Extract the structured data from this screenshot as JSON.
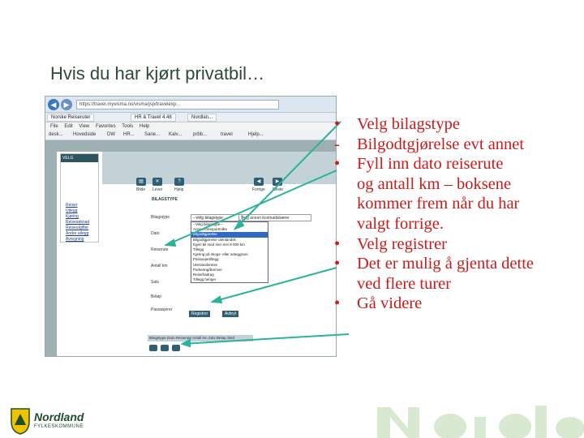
{
  "slide": {
    "title": "Hvis du har kjørt privatbil…",
    "bullets": [
      {
        "marker": "•",
        "lines": [
          "Velg bilagstype"
        ]
      },
      {
        "marker": "-",
        "lines": [
          "Bilgodtgjørelse evt annet"
        ]
      },
      {
        "marker": "•",
        "lines": [
          "Fyll inn dato reiserute",
          "og antall km – boksene",
          "kommer frem når du har",
          "valgt forrige."
        ]
      },
      {
        "marker": "•",
        "lines": [
          "Velg registrer"
        ]
      },
      {
        "marker": "•",
        "lines": [
          "Det er mulig å gjenta dette",
          "ved flere turer"
        ]
      },
      {
        "marker": "•",
        "lines": [
          "Gå videre"
        ]
      }
    ],
    "colors": {
      "title": "#2e4a36",
      "bullets": "#cc1a1a",
      "arrows": "#2bb39a",
      "logo": "#1d4f2a"
    }
  },
  "screenshot": {
    "address_url": "https://travel.myvisma.no/visma/jsp/travelexp...",
    "tabs": [
      "Norske Reiseruter",
      "HR & Travel 4.48",
      "Nordlan..."
    ],
    "menu": [
      "File",
      "Edit",
      "View",
      "Favorites",
      "Tools",
      "Help"
    ],
    "favorites": [
      "desk...",
      "Hovedside",
      "DW",
      "HR...",
      "Sane...",
      "Kalv...",
      "prbb...",
      "travel",
      "Hjelp..."
    ],
    "left_nav_header": "VELG",
    "left_nav_links": [
      "Reiser",
      "Utlegg",
      "Kjøring",
      "Reisesøknad",
      "Reiseutgifter",
      "Andre utlegg",
      "Avregning"
    ],
    "toolbar_icon_labels": [
      "Bilde",
      "Lever",
      "Hjelp"
    ],
    "toolbar_right_labels": [
      "Forrige",
      "Neste"
    ],
    "section_title": "BILAGSTYPE",
    "form_labels": [
      "Bilagstype",
      "Dato",
      "Reiserute",
      "Antall km",
      "Sats",
      "Beløp",
      "Passasjerer"
    ],
    "select_value": "--Velg bilagstype",
    "dropdown_options": [
      "--Velg bilagstype--",
      "Annen transportmåte",
      "Bilgodtgjørelse",
      "Bilgodtgjørelse utenlandsk",
      "Egen bil med mer enn 9 000 km",
      "Tillegg",
      "Kjøring på skogs- eller anleggsvei",
      "Passasjertillegg",
      "Utenlandsreise",
      "Parkering/Bomvei",
      "Reisefradrag",
      "Tillegg henger"
    ],
    "fieldbox_text": "Velg annen kostnadsbærer",
    "buttons": [
      "Registrer",
      "Avbryt"
    ],
    "bottom_header": "Bilagstype  Dato  Reiserute  Antall km  Sats  Beløp  Slett"
  },
  "footer": {
    "logo_text": "Nordland",
    "logo_sub": "FYLKESKOMMUNE"
  }
}
